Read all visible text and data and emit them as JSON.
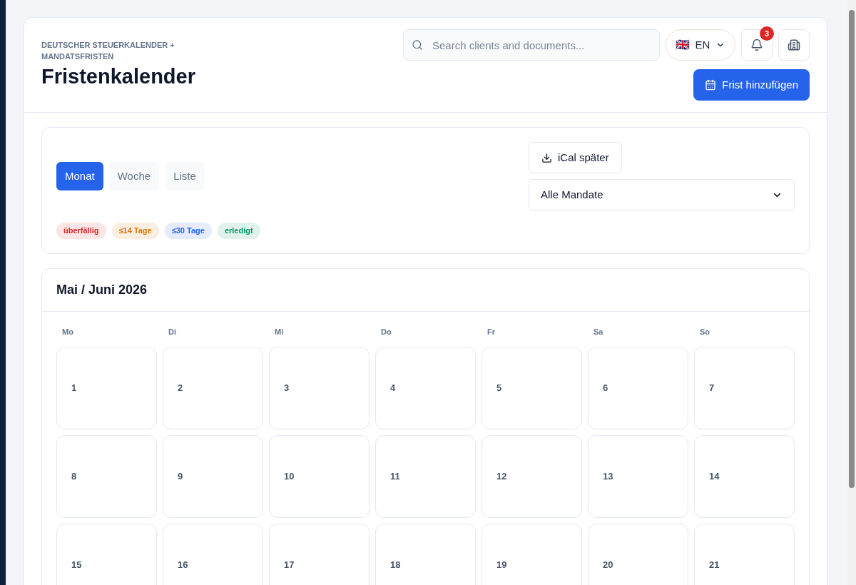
{
  "header": {
    "eyebrow": "DEUTSCHER STEUERKALENDER + MANDATSFRISTEN",
    "title": "Fristenkalender",
    "search": {
      "placeholder": "Search clients and documents..."
    },
    "language": {
      "flag": "🇬🇧",
      "code": "EN"
    },
    "notifications": {
      "count": "3"
    },
    "add_button": "Frist hinzufügen"
  },
  "filters": {
    "views": [
      {
        "label": "Monat",
        "selected": true
      },
      {
        "label": "Woche",
        "selected": false
      },
      {
        "label": "Liste",
        "selected": false
      }
    ],
    "legend": [
      {
        "label": "überfällig",
        "color": "#dc2626"
      },
      {
        "label": "≤14 Tage",
        "color": "#d97706"
      },
      {
        "label": "≤30 Tage",
        "color": "#2563eb"
      },
      {
        "label": "erledigt",
        "color": "#059669"
      }
    ],
    "ical_button": "iCal später",
    "mandate_select": "Alle Mandate"
  },
  "calendar": {
    "title": "Mai / Juni 2026",
    "weekdays": [
      "Mo",
      "Di",
      "Mi",
      "Do",
      "Fr",
      "Sa",
      "So"
    ],
    "weeks": [
      [
        "1",
        "2",
        "3",
        "4",
        "5",
        "6",
        "7"
      ],
      [
        "8",
        "9",
        "10",
        "11",
        "12",
        "13",
        "14"
      ],
      [
        "15",
        "16",
        "17",
        "18",
        "19",
        "20",
        "21"
      ]
    ]
  }
}
